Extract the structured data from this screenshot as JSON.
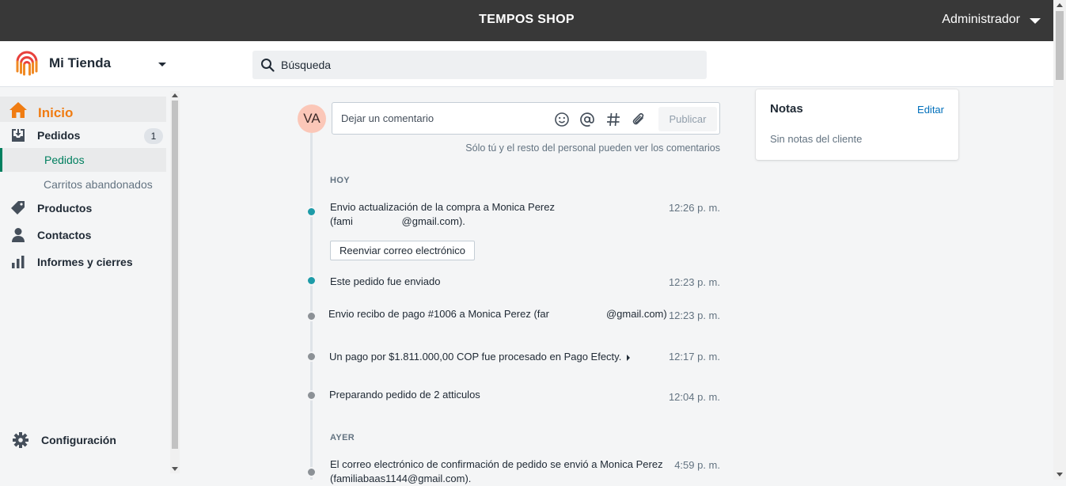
{
  "topbar": {
    "brand": "TEMPOS SHOP",
    "user": "Administrador"
  },
  "store": {
    "name": "Mi Tienda"
  },
  "search": {
    "placeholder": "Búsqueda"
  },
  "sidebar": {
    "items": [
      {
        "label": "Inicio",
        "icon": "home-icon"
      },
      {
        "label": "Pedidos",
        "icon": "inbox-download-icon",
        "badge": "1"
      },
      {
        "label": "Productos",
        "icon": "tag-icon"
      },
      {
        "label": "Contactos",
        "icon": "person-icon"
      },
      {
        "label": "Informes y cierres",
        "icon": "bar-chart-icon"
      }
    ],
    "subitems": [
      {
        "label": "Pedidos",
        "active": true
      },
      {
        "label": "Carritos abandonados",
        "active": false
      }
    ],
    "settings": {
      "label": "Configuración",
      "icon": "gear-icon"
    }
  },
  "comment": {
    "avatar_initials": "VA",
    "placeholder": "Dejar un comentario",
    "publish_label": "Publicar",
    "hint": "Sólo tú y el resto del personal pueden ver los comentarios"
  },
  "timeline": {
    "groups": [
      {
        "label": "HOY"
      },
      {
        "label": "AYER"
      }
    ],
    "events": [
      {
        "line1": "Envio actualización de la compra a Monica Perez",
        "line2a": "(fami",
        "line2b": "@gmail.com).",
        "time": "12:26 p. m.",
        "action": "Reenviar correo electrónico"
      },
      {
        "text": "Este pedido fue enviado",
        "time": "12:23 p. m."
      },
      {
        "text_a": "Envio recibo de pago #1006 a Monica Perez (far",
        "text_b": "@gmail.com)",
        "time": "12:23 p. m."
      },
      {
        "text": "Un pago por $1.811.000,00 COP fue procesado en Pago Efecty.",
        "time": "12:17 p. m."
      },
      {
        "text": "Preparando pedido de 2 atticulos",
        "time": "12:04 p. m."
      },
      {
        "line1": "El correo electrónico de confirmación de pedido se envió a Monica Perez",
        "line2": "(familiabaas1144@gmail.com).",
        "time": "4:59 p. m."
      }
    ]
  },
  "notes": {
    "title": "Notas",
    "edit_label": "Editar",
    "empty": "Sin notas del cliente"
  },
  "colors": {
    "topbar": "#383838",
    "accent_orange": "#f07c12",
    "active_green": "#007f5f",
    "link_blue": "#006fbb",
    "dot_teal": "#1d9ba8",
    "dot_gray": "#8c9196"
  }
}
